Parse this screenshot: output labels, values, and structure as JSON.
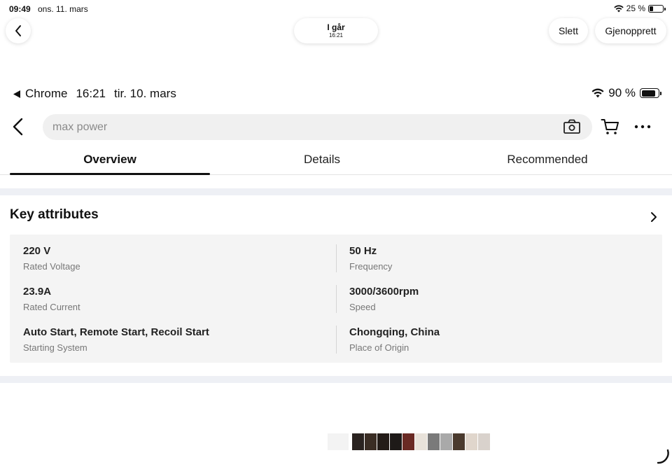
{
  "viewer": {
    "status": {
      "time": "09:49",
      "date": "ons. 11. mars",
      "battery": "25 %",
      "battery_level": 0.25
    },
    "date_pill": {
      "line1": "I går",
      "line2": "16:21"
    },
    "delete_label": "Slett",
    "restore_label": "Gjenopprett",
    "thumbnail_colors": [
      "#f3f3f3",
      "#2a2320",
      "#3a2d24",
      "#231c18",
      "#1e1a18",
      "#6a2a24",
      "#e8e2da",
      "#7a7a7a",
      "#a9a9a9",
      "#4a3a2e",
      "#e0d6cc",
      "#d9d2cc"
    ]
  },
  "inner_status": {
    "back_app": "Chrome",
    "time": "16:21",
    "date": "tir. 10. mars",
    "battery": "90 %",
    "battery_level": 0.9
  },
  "search": {
    "placeholder": "max power"
  },
  "tabs": [
    {
      "label": "Overview",
      "active": true
    },
    {
      "label": "Details",
      "active": false
    },
    {
      "label": "Recommended",
      "active": false
    }
  ],
  "key_attributes": {
    "title": "Key attributes",
    "items": [
      {
        "value": "220 V",
        "label": "Rated Voltage"
      },
      {
        "value": "50 Hz",
        "label": "Frequency"
      },
      {
        "value": "23.9A",
        "label": "Rated Current"
      },
      {
        "value": "3000/3600rpm",
        "label": "Speed"
      },
      {
        "value": "Auto Start, Remote Start, Recoil Start",
        "label": "Starting System"
      },
      {
        "value": "Chongqing, China",
        "label": "Place of Origin"
      }
    ]
  }
}
